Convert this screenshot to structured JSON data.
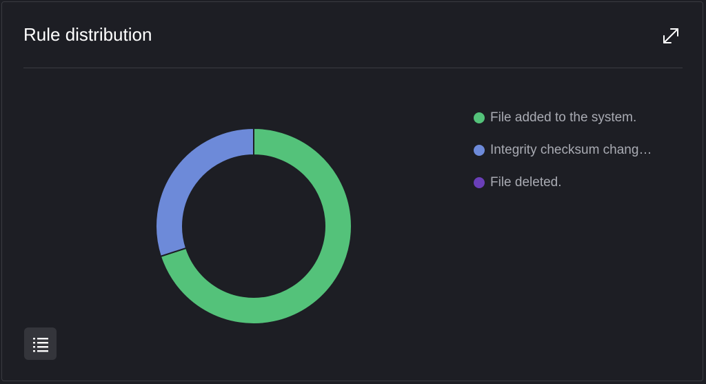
{
  "panel": {
    "title": "Rule distribution"
  },
  "icons": {
    "expand": "expand-arrows-icon",
    "table_toggle": "list-icon"
  },
  "chart_data": {
    "type": "pie",
    "donut": true,
    "legend_position": "right",
    "series": [
      {
        "name": "File added to the system.",
        "value": 70,
        "color": "#54c27a"
      },
      {
        "name": "Integrity checksum chang…",
        "value": 30,
        "color": "#6d8ad9"
      },
      {
        "name": "File deleted.",
        "value": 0,
        "color": "#6a3fb8"
      }
    ]
  }
}
